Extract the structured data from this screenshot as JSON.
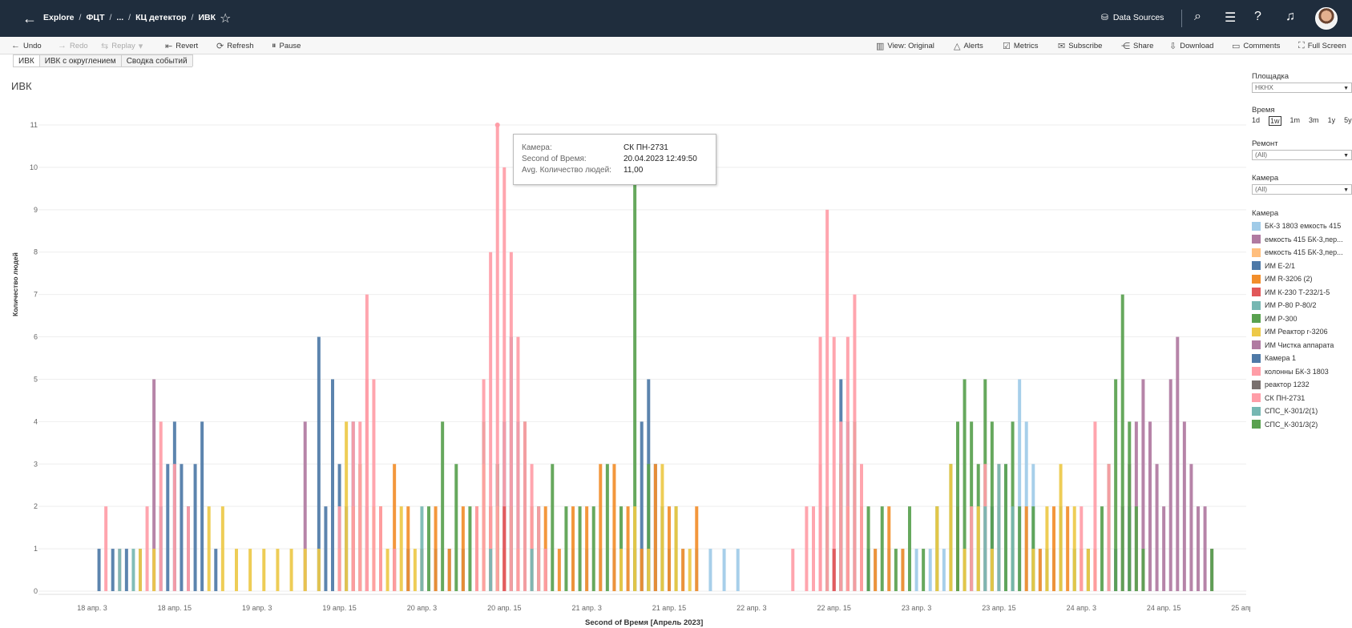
{
  "topbar": {
    "breadcrumbs": [
      "Explore",
      "ФЦТ",
      "...",
      "КЦ детектор",
      "ИВК"
    ],
    "data_sources_label": "Data Sources"
  },
  "toolbar": {
    "undo": "Undo",
    "redo": "Redo",
    "replay": "Replay",
    "revert": "Revert",
    "refresh": "Refresh",
    "pause": "Pause",
    "view_original": "View: Original",
    "alerts": "Alerts",
    "metrics": "Metrics",
    "subscribe": "Subscribe",
    "share": "Share",
    "download": "Download",
    "comments": "Comments",
    "full_screen": "Full Screen"
  },
  "tabs": [
    "ИВК",
    "ИВК с округлением",
    "Сводка событий"
  ],
  "sheet_title": "ИВК",
  "tooltip": {
    "rows": [
      {
        "key": "Камера:",
        "value": "СК ПН-2731"
      },
      {
        "key": "Second of Время:",
        "value": "20.04.2023 12:49:50"
      },
      {
        "key": "Avg. Количество людей:",
        "value": "11,00"
      }
    ]
  },
  "filters": {
    "site_title": "Площадка",
    "site_value": "НКНХ",
    "time_title": "Время",
    "time_buttons": [
      "1d",
      "1w",
      "1m",
      "3m",
      "1y",
      "5y"
    ],
    "time_selected": "1w",
    "repair_title": "Ремонт",
    "repair_value": "(All)",
    "camera_title": "Камера",
    "camera_value": "(All)",
    "legend_title": "Камера"
  },
  "legend": [
    {
      "label": "БК-3 1803 емкость 415",
      "color": "#a0cbe8"
    },
    {
      "label": "емкость 415 БК-3,пер...",
      "color": "#b07aa1"
    },
    {
      "label": "емкость 415 БК-3,пер...",
      "color": "#ffbe7d"
    },
    {
      "label": "ИМ Е-2/1",
      "color": "#4e79a7"
    },
    {
      "label": "ИМ R-3206 (2)",
      "color": "#f28e2b"
    },
    {
      "label": "ИМ К-230 Т-232/1-5",
      "color": "#e15759"
    },
    {
      "label": "ИМ Р-80 Р-80/2",
      "color": "#76b7b2"
    },
    {
      "label": "ИМ Р-300",
      "color": "#59a14f"
    },
    {
      "label": "ИМ Реактор r-3206",
      "color": "#edc948"
    },
    {
      "label": "ИМ Чистка аппарата",
      "color": "#b07aa1"
    },
    {
      "label": "Камера 1",
      "color": "#4e79a7"
    },
    {
      "label": "колонны БК-3 1803",
      "color": "#ff9da7"
    },
    {
      "label": "реактор 1232",
      "color": "#79706e"
    },
    {
      "label": "СК ПН-2731",
      "color": "#ff9da7"
    },
    {
      "label": "СПС_К-301/2(1)",
      "color": "#76b7b2"
    },
    {
      "label": "СПС_К-301/3(2)",
      "color": "#59a14f"
    }
  ],
  "chart_data": {
    "type": "area",
    "ylabel": "Количество людей",
    "xlabel": "Second of Время [Апрель 2023]",
    "y_ticks": [
      "0",
      "1",
      "2",
      "3",
      "4",
      "5",
      "6",
      "7",
      "8",
      "9",
      "10",
      "11"
    ],
    "ylim": [
      0,
      11
    ],
    "x_ticks": [
      "18 апр. 3",
      "18 апр. 15",
      "19 апр. 3",
      "19 апр. 15",
      "20 апр. 3",
      "20 апр. 15",
      "21 апр. 3",
      "21 апр. 15",
      "22 апр. 3",
      "22 апр. 15",
      "23 апр. 3",
      "23 апр. 15",
      "24 апр. 3",
      "24 апр. 15",
      "25 апр. 3"
    ],
    "x_unit": "hours from 18 апр. 03:00",
    "xlim": [
      0,
      168
    ],
    "grid": true,
    "series": [
      {
        "name": "БК-3 1803 емкость 415",
        "color": "#a0cbe8",
        "points": [
          [
            70,
            1
          ],
          [
            72,
            1
          ],
          [
            74,
            1
          ],
          [
            76,
            1
          ],
          [
            78,
            1
          ],
          [
            80,
            1
          ],
          [
            82,
            1
          ],
          [
            84,
            1
          ],
          [
            86,
            1
          ],
          [
            88,
            1
          ],
          [
            90,
            1
          ],
          [
            92,
            1
          ],
          [
            94,
            1
          ],
          [
            112,
            1
          ],
          [
            114,
            1
          ],
          [
            116,
            1
          ],
          [
            118,
            1
          ],
          [
            120,
            1
          ],
          [
            122,
            1
          ],
          [
            124,
            1
          ],
          [
            126,
            1
          ],
          [
            128,
            1
          ],
          [
            130,
            1
          ],
          [
            132,
            3
          ],
          [
            133,
            3
          ],
          [
            134,
            2
          ],
          [
            135,
            5
          ],
          [
            136,
            4
          ],
          [
            137,
            3
          ],
          [
            138,
            1
          ],
          [
            140,
            1
          ]
        ]
      },
      {
        "name": "емкость 415 БК-3,пер...",
        "color": "#b07aa1",
        "points": [
          [
            9,
            5
          ],
          [
            31,
            4
          ],
          [
            150,
            2
          ],
          [
            151,
            3
          ],
          [
            152,
            4
          ],
          [
            153,
            5
          ],
          [
            154,
            4
          ],
          [
            155,
            3
          ],
          [
            156,
            2
          ],
          [
            157,
            5
          ],
          [
            158,
            6
          ],
          [
            159,
            4
          ],
          [
            160,
            3
          ],
          [
            161,
            2
          ],
          [
            162,
            2
          ],
          [
            163,
            1
          ]
        ]
      },
      {
        "name": "ИМ Е-2/1",
        "color": "#4e79a7",
        "points": [
          [
            1,
            1
          ],
          [
            3,
            1
          ],
          [
            5,
            1
          ],
          [
            7,
            1
          ],
          [
            10,
            2
          ],
          [
            11,
            3
          ],
          [
            12,
            4
          ],
          [
            13,
            3
          ],
          [
            14,
            2
          ],
          [
            15,
            3
          ],
          [
            16,
            4
          ],
          [
            18,
            1
          ],
          [
            33,
            6
          ],
          [
            34,
            2
          ],
          [
            35,
            5
          ],
          [
            36,
            3
          ],
          [
            37,
            2
          ],
          [
            38,
            4
          ],
          [
            39,
            3
          ],
          [
            40,
            2
          ],
          [
            42,
            1
          ],
          [
            44,
            1
          ],
          [
            46,
            1
          ],
          [
            48,
            1
          ],
          [
            50,
            1
          ],
          [
            52,
            1
          ],
          [
            54,
            1
          ],
          [
            56,
            1
          ],
          [
            58,
            2
          ],
          [
            59,
            3
          ],
          [
            60,
            4
          ],
          [
            61,
            6
          ],
          [
            62,
            4
          ],
          [
            63,
            3
          ],
          [
            64,
            2
          ],
          [
            66,
            1
          ],
          [
            79,
            1
          ],
          [
            80,
            4
          ],
          [
            81,
            5
          ],
          [
            82,
            3
          ],
          [
            83,
            2
          ],
          [
            84,
            1
          ],
          [
            108,
            1
          ],
          [
            109,
            5
          ],
          [
            110,
            4
          ],
          [
            111,
            3
          ],
          [
            112,
            2
          ],
          [
            113,
            1
          ],
          [
            131,
            2
          ],
          [
            149,
            1
          ],
          [
            151,
            2
          ]
        ]
      },
      {
        "name": "ИМ R-3206 (2)",
        "color": "#f28e2b",
        "points": [
          [
            36,
            1
          ],
          [
            38,
            2
          ],
          [
            40,
            1
          ],
          [
            42,
            2
          ],
          [
            44,
            3
          ],
          [
            46,
            2
          ],
          [
            48,
            1
          ],
          [
            50,
            2
          ],
          [
            52,
            1
          ],
          [
            54,
            2
          ],
          [
            56,
            2
          ],
          [
            58,
            2
          ],
          [
            60,
            1
          ],
          [
            62,
            1
          ],
          [
            64,
            2
          ],
          [
            66,
            2
          ],
          [
            68,
            1
          ],
          [
            70,
            2
          ],
          [
            72,
            2
          ],
          [
            74,
            3
          ],
          [
            76,
            3
          ],
          [
            78,
            2
          ],
          [
            80,
            1
          ],
          [
            82,
            3
          ],
          [
            84,
            2
          ],
          [
            86,
            1
          ],
          [
            88,
            2
          ],
          [
            110,
            2
          ],
          [
            112,
            2
          ],
          [
            114,
            1
          ],
          [
            116,
            2
          ],
          [
            118,
            1
          ],
          [
            126,
            2
          ],
          [
            134,
            2
          ],
          [
            136,
            2
          ],
          [
            138,
            1
          ],
          [
            140,
            2
          ],
          [
            142,
            2
          ],
          [
            144,
            1
          ],
          [
            146,
            1
          ]
        ]
      },
      {
        "name": "ИМ Р-300",
        "color": "#59a14f",
        "points": [
          [
            49,
            2
          ],
          [
            51,
            4
          ],
          [
            53,
            3
          ],
          [
            55,
            2
          ],
          [
            57,
            4
          ],
          [
            59,
            3
          ],
          [
            61,
            2
          ],
          [
            63,
            4
          ],
          [
            65,
            2
          ],
          [
            67,
            3
          ],
          [
            69,
            2
          ],
          [
            71,
            2
          ],
          [
            73,
            2
          ],
          [
            75,
            3
          ],
          [
            77,
            2
          ],
          [
            79,
            10
          ],
          [
            81,
            3
          ],
          [
            83,
            2
          ],
          [
            85,
            2
          ],
          [
            107,
            2
          ],
          [
            109,
            3
          ],
          [
            111,
            4
          ],
          [
            113,
            2
          ],
          [
            115,
            2
          ],
          [
            117,
            1
          ],
          [
            119,
            2
          ],
          [
            121,
            1
          ],
          [
            123,
            2
          ],
          [
            125,
            3
          ],
          [
            126,
            4
          ],
          [
            127,
            5
          ],
          [
            128,
            4
          ],
          [
            129,
            3
          ],
          [
            130,
            5
          ],
          [
            131,
            4
          ],
          [
            132,
            2
          ],
          [
            133,
            3
          ],
          [
            134,
            4
          ],
          [
            135,
            2
          ],
          [
            137,
            2
          ],
          [
            139,
            1
          ],
          [
            141,
            2
          ],
          [
            143,
            1
          ],
          [
            145,
            1
          ],
          [
            147,
            2
          ],
          [
            148,
            3
          ],
          [
            149,
            5
          ],
          [
            150,
            7
          ],
          [
            151,
            4
          ],
          [
            152,
            2
          ],
          [
            153,
            1
          ],
          [
            163,
            1
          ]
        ]
      },
      {
        "name": "ИМ Реактор r-3206",
        "color": "#edc948",
        "points": [
          [
            7,
            1
          ],
          [
            9,
            1
          ],
          [
            17,
            2
          ],
          [
            19,
            2
          ],
          [
            21,
            1
          ],
          [
            23,
            1
          ],
          [
            25,
            1
          ],
          [
            27,
            1
          ],
          [
            29,
            1
          ],
          [
            31,
            1
          ],
          [
            33,
            1
          ],
          [
            37,
            4
          ],
          [
            39,
            3
          ],
          [
            41,
            2
          ],
          [
            43,
            1
          ],
          [
            45,
            2
          ],
          [
            47,
            1
          ],
          [
            57,
            3
          ],
          [
            59,
            2
          ],
          [
            77,
            1
          ],
          [
            79,
            2
          ],
          [
            81,
            1
          ],
          [
            83,
            3
          ],
          [
            85,
            2
          ],
          [
            87,
            1
          ],
          [
            123,
            2
          ],
          [
            125,
            3
          ],
          [
            127,
            1
          ],
          [
            129,
            2
          ],
          [
            131,
            1
          ],
          [
            137,
            1
          ],
          [
            139,
            2
          ],
          [
            141,
            3
          ],
          [
            143,
            2
          ],
          [
            145,
            1
          ]
        ]
      },
      {
        "name": "колонны БК-3 1803",
        "color": "#ff9da7",
        "points": [
          [
            2,
            2
          ],
          [
            4,
            1
          ],
          [
            8,
            2
          ],
          [
            10,
            4
          ],
          [
            12,
            3
          ],
          [
            14,
            2
          ],
          [
            36,
            2
          ],
          [
            38,
            4
          ],
          [
            40,
            5
          ],
          [
            42,
            2
          ],
          [
            44,
            1
          ],
          [
            102,
            1
          ],
          [
            104,
            2
          ],
          [
            106,
            3
          ],
          [
            128,
            2
          ],
          [
            130,
            3
          ],
          [
            132,
            3
          ],
          [
            144,
            2
          ],
          [
            146,
            4
          ],
          [
            148,
            3
          ]
        ]
      },
      {
        "name": "СК ПН-2731",
        "color": "#ff9da7",
        "points": [
          [
            39,
            4
          ],
          [
            40,
            7
          ],
          [
            41,
            5
          ],
          [
            56,
            2
          ],
          [
            57,
            5
          ],
          [
            58,
            8
          ],
          [
            59,
            11
          ],
          [
            60,
            10
          ],
          [
            61,
            8
          ],
          [
            62,
            6
          ],
          [
            63,
            4
          ],
          [
            64,
            3
          ],
          [
            65,
            2
          ],
          [
            66,
            1
          ],
          [
            105,
            2
          ],
          [
            106,
            6
          ],
          [
            107,
            9
          ],
          [
            108,
            6
          ],
          [
            109,
            4
          ],
          [
            110,
            6
          ],
          [
            111,
            7
          ],
          [
            112,
            3
          ]
        ]
      },
      {
        "name": "СПС_К-301/2(1)",
        "color": "#76b7b2",
        "points": [
          [
            4,
            1
          ],
          [
            6,
            1
          ],
          [
            48,
            2
          ],
          [
            58,
            1
          ],
          [
            64,
            1
          ],
          [
            130,
            2
          ],
          [
            132,
            3
          ],
          [
            134,
            2
          ]
        ]
      },
      {
        "name": "ИМ К-230 Т-232/1-5",
        "color": "#e15759",
        "points": [
          [
            60,
            2
          ],
          [
            108,
            1
          ]
        ]
      }
    ]
  }
}
